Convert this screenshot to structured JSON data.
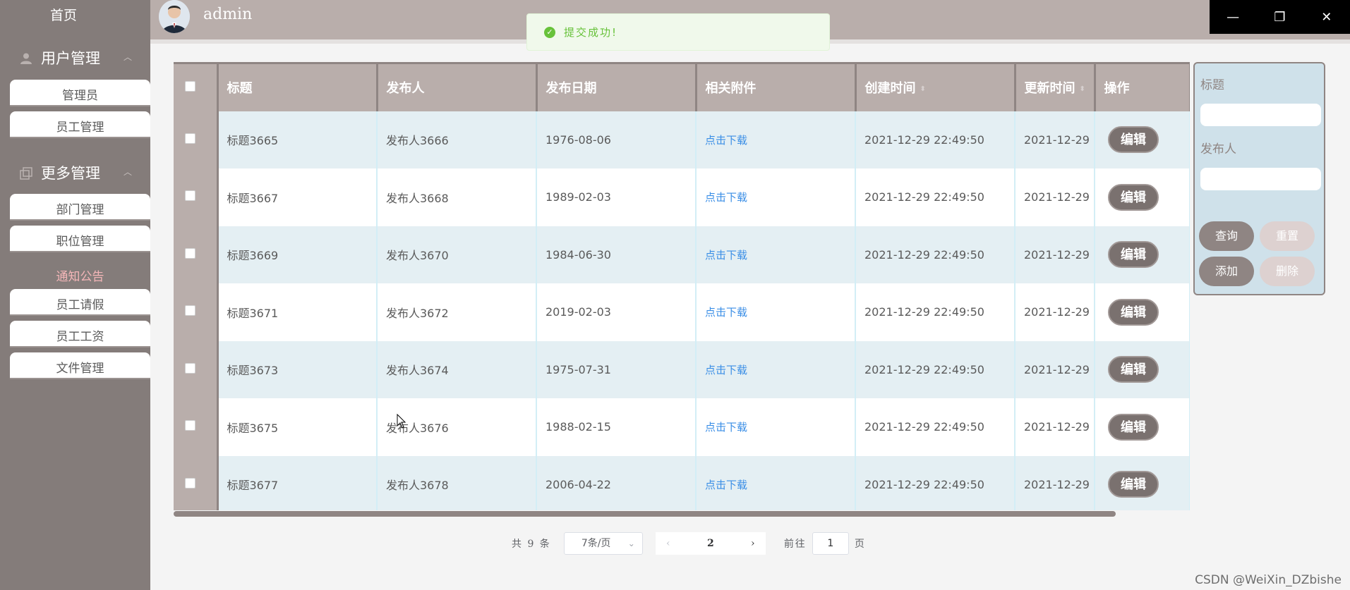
{
  "sidebar": {
    "home": "首页",
    "groups": [
      {
        "label": "用户管理",
        "items": [
          "管理员",
          "员工管理"
        ]
      },
      {
        "label": "更多管理",
        "items": [
          "部门管理",
          "职位管理",
          "通知公告",
          "员工请假",
          "员工工资",
          "文件管理"
        ]
      }
    ],
    "active_item": "通知公告"
  },
  "header": {
    "username": "admin"
  },
  "toast": {
    "message": "提交成功!"
  },
  "table": {
    "columns": [
      "标题",
      "发布人",
      "发布日期",
      "相关附件",
      "创建时间",
      "更新时间",
      "操作"
    ],
    "rows": [
      {
        "title": "标题3665",
        "publisher": "发布人3666",
        "date": "1976-08-06",
        "attachment": "点击下载",
        "created": "2021-12-29 22:49:50",
        "updated": "2021-12-29",
        "action": "编辑"
      },
      {
        "title": "标题3667",
        "publisher": "发布人3668",
        "date": "1989-02-03",
        "attachment": "点击下载",
        "created": "2021-12-29 22:49:50",
        "updated": "2021-12-29",
        "action": "编辑"
      },
      {
        "title": "标题3669",
        "publisher": "发布人3670",
        "date": "1984-06-30",
        "attachment": "点击下载",
        "created": "2021-12-29 22:49:50",
        "updated": "2021-12-29",
        "action": "编辑"
      },
      {
        "title": "标题3671",
        "publisher": "发布人3672",
        "date": "2019-02-03",
        "attachment": "点击下载",
        "created": "2021-12-29 22:49:50",
        "updated": "2021-12-29",
        "action": "编辑"
      },
      {
        "title": "标题3673",
        "publisher": "发布人3674",
        "date": "1975-07-31",
        "attachment": "点击下载",
        "created": "2021-12-29 22:49:50",
        "updated": "2021-12-29",
        "action": "编辑"
      },
      {
        "title": "标题3675",
        "publisher": "发布人3676",
        "date": "1988-02-15",
        "attachment": "点击下载",
        "created": "2021-12-29 22:49:50",
        "updated": "2021-12-29",
        "action": "编辑"
      },
      {
        "title": "标题3677",
        "publisher": "发布人3678",
        "date": "2006-04-22",
        "attachment": "点击下载",
        "created": "2021-12-29 22:49:50",
        "updated": "2021-12-29",
        "action": "编辑"
      }
    ]
  },
  "search_panel": {
    "title_label": "标题",
    "title_value": "",
    "publisher_label": "发布人",
    "publisher_value": "",
    "query": "查询",
    "reset": "重置",
    "add": "添加",
    "delete": "删除"
  },
  "pagination": {
    "total": "共 9 条",
    "page_size": "7条/页",
    "current_page": "2",
    "goto_label": "前往",
    "goto_value": "1",
    "page_suffix": "页"
  },
  "colors": {
    "sidebar": "#847c7a",
    "header": "#b9aeab",
    "row_alt": "#e4eff3",
    "link": "#3a8ee6",
    "success": "#67c23a"
  },
  "watermark": "CSDN @WeiXin_DZbishe"
}
